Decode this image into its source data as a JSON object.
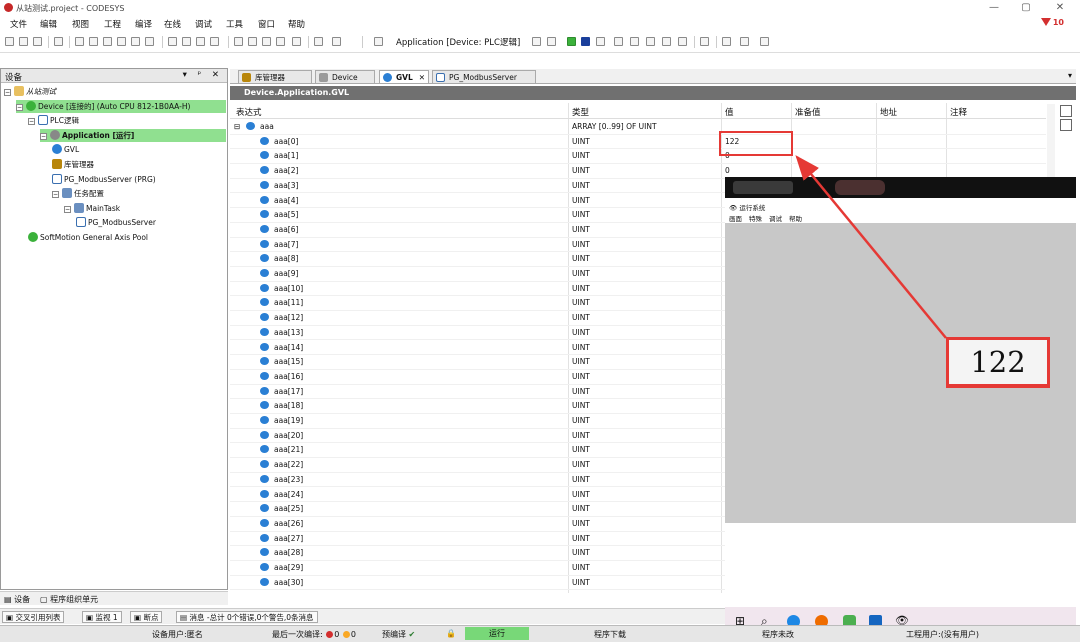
{
  "window": {
    "title": "从站测试.project - CODESYS",
    "controls": [
      "—",
      "▢",
      "✕"
    ],
    "error_badge": "10"
  },
  "menu": [
    "文件",
    "编辑",
    "视图",
    "工程",
    "编译",
    "在线",
    "调试",
    "工具",
    "窗口",
    "帮助"
  ],
  "toolbar": {
    "application_label": "Application [Device: PLC逻辑]"
  },
  "devices_panel": {
    "title": "设备",
    "controls": "▾ ᵖ ✕",
    "tree": [
      {
        "label": "从站测试",
        "indent": 0,
        "icon": "project-icon",
        "toggle": "⊟",
        "highlight": false
      },
      {
        "label": "Device [连接的] (Auto CPU 812-1B0AA-H)",
        "indent": 1,
        "icon": "device-icon",
        "toggle": "⊟",
        "highlight": true
      },
      {
        "label": "PLC逻辑",
        "indent": 2,
        "icon": "plc-logic-icon",
        "toggle": "⊟",
        "highlight": false
      },
      {
        "label": "Application [运行]",
        "indent": 3,
        "icon": "application-icon",
        "toggle": "⊟",
        "highlight": true,
        "bold": true
      },
      {
        "label": "GVL",
        "indent": 4,
        "icon": "gvl-icon",
        "toggle": "",
        "highlight": false
      },
      {
        "label": "库管理器",
        "indent": 4,
        "icon": "library-manager-icon",
        "toggle": "",
        "highlight": false
      },
      {
        "label": "PG_ModbusServer (PRG)",
        "indent": 4,
        "icon": "program-icon",
        "toggle": "",
        "highlight": false
      },
      {
        "label": "任务配置",
        "indent": 4,
        "icon": "task-config-icon",
        "toggle": "⊟",
        "highlight": false
      },
      {
        "label": "MainTask",
        "indent": 5,
        "icon": "task-icon",
        "toggle": "⊟",
        "highlight": false
      },
      {
        "label": "PG_ModbusServer",
        "indent": 6,
        "icon": "program-icon",
        "toggle": "",
        "highlight": false
      },
      {
        "label": "SoftMotion General Axis Pool",
        "indent": 2,
        "icon": "axis-pool-icon",
        "toggle": "",
        "highlight": false
      }
    ],
    "bottom_tabs": [
      "设备",
      "程序组织单元"
    ]
  },
  "editor": {
    "tabs": [
      {
        "label": "库管理器",
        "active": false
      },
      {
        "label": "Device",
        "active": false
      },
      {
        "label": "GVL",
        "active": true
      },
      {
        "label": "PG_ModbusServer",
        "active": false
      }
    ],
    "path": "Device.Application.GVL",
    "columns": [
      "表达式",
      "类型",
      "值",
      "准备值",
      "地址",
      "注释"
    ],
    "root": {
      "expr": "aaa",
      "type": "ARRAY [0..99] OF UINT"
    },
    "rows": [
      {
        "expr": "aaa[0]",
        "type": "UINT",
        "value": "122"
      },
      {
        "expr": "aaa[1]",
        "type": "UINT",
        "value": "0"
      },
      {
        "expr": "aaa[2]",
        "type": "UINT",
        "value": "0"
      },
      {
        "expr": "aaa[3]",
        "type": "UINT",
        "value": ""
      },
      {
        "expr": "aaa[4]",
        "type": "UINT",
        "value": ""
      },
      {
        "expr": "aaa[5]",
        "type": "UINT",
        "value": ""
      },
      {
        "expr": "aaa[6]",
        "type": "UINT",
        "value": ""
      },
      {
        "expr": "aaa[7]",
        "type": "UINT",
        "value": ""
      },
      {
        "expr": "aaa[8]",
        "type": "UINT",
        "value": ""
      },
      {
        "expr": "aaa[9]",
        "type": "UINT",
        "value": ""
      },
      {
        "expr": "aaa[10]",
        "type": "UINT",
        "value": ""
      },
      {
        "expr": "aaa[11]",
        "type": "UINT",
        "value": ""
      },
      {
        "expr": "aaa[12]",
        "type": "UINT",
        "value": ""
      },
      {
        "expr": "aaa[13]",
        "type": "UINT",
        "value": ""
      },
      {
        "expr": "aaa[14]",
        "type": "UINT",
        "value": ""
      },
      {
        "expr": "aaa[15]",
        "type": "UINT",
        "value": ""
      },
      {
        "expr": "aaa[16]",
        "type": "UINT",
        "value": ""
      },
      {
        "expr": "aaa[17]",
        "type": "UINT",
        "value": ""
      },
      {
        "expr": "aaa[18]",
        "type": "UINT",
        "value": ""
      },
      {
        "expr": "aaa[19]",
        "type": "UINT",
        "value": ""
      },
      {
        "expr": "aaa[20]",
        "type": "UINT",
        "value": ""
      },
      {
        "expr": "aaa[21]",
        "type": "UINT",
        "value": ""
      },
      {
        "expr": "aaa[22]",
        "type": "UINT",
        "value": ""
      },
      {
        "expr": "aaa[23]",
        "type": "UINT",
        "value": ""
      },
      {
        "expr": "aaa[24]",
        "type": "UINT",
        "value": ""
      },
      {
        "expr": "aaa[25]",
        "type": "UINT",
        "value": ""
      },
      {
        "expr": "aaa[26]",
        "type": "UINT",
        "value": ""
      },
      {
        "expr": "aaa[27]",
        "type": "UINT",
        "value": ""
      },
      {
        "expr": "aaa[28]",
        "type": "UINT",
        "value": ""
      },
      {
        "expr": "aaa[29]",
        "type": "UINT",
        "value": ""
      },
      {
        "expr": "aaa[30]",
        "type": "UINT",
        "value": ""
      }
    ]
  },
  "runtime_window": {
    "title": "运行系统",
    "menu": [
      "画面",
      "特殊",
      "调试",
      "帮助"
    ],
    "display_value": "122"
  },
  "bottom_tabs": [
    "交叉引用列表",
    "监视 1",
    "断点"
  ],
  "messages_summary": "消息 -总计 0个错误,0个警告,0条消息",
  "status": {
    "device_user": "设备用户:匿名",
    "last_compile": "最后一次编译:",
    "errors": "0",
    "warnings": "0",
    "precompile": "预编译",
    "run_state": "运行",
    "download": "程序下载",
    "change_state": "程序未改",
    "project_user": "工程用户:(没有用户)"
  },
  "colors": {
    "highlight_green": "#90e090",
    "path_header": "#707070",
    "annotation_red": "#e53935"
  }
}
